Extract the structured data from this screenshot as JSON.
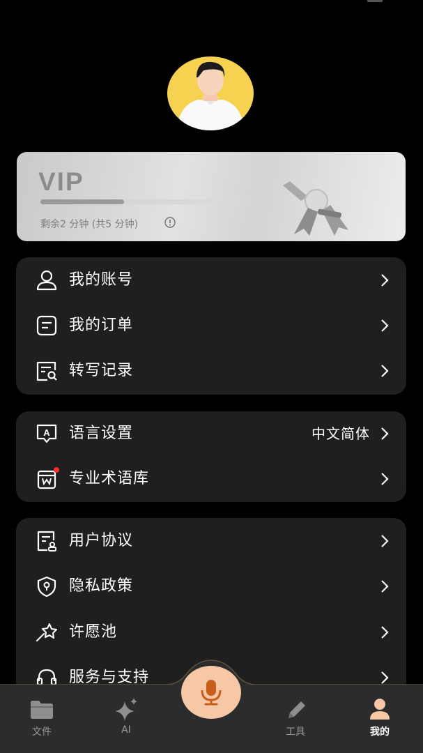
{
  "profile": {
    "avatar_icon": "user-avatar"
  },
  "vip": {
    "title": "VIP",
    "remaining_text": "剩余2 分钟 (共5 分钟)",
    "remaining_minutes": 2,
    "total_minutes": 5,
    "progress_fraction": 0.4
  },
  "groups": {
    "account": [
      {
        "label": "我的账号",
        "icon": "user-icon"
      },
      {
        "label": "我的订单",
        "icon": "order-icon"
      },
      {
        "label": "转写记录",
        "icon": "transcript-record-icon"
      }
    ],
    "settings": [
      {
        "label": "语言设置",
        "icon": "language-icon",
        "value": "中文简体"
      },
      {
        "label": "专业术语库",
        "icon": "glossary-icon",
        "badge": "red-dot"
      }
    ],
    "info": [
      {
        "label": "用户协议",
        "icon": "agreement-icon"
      },
      {
        "label": "隐私政策",
        "icon": "privacy-shield-icon"
      },
      {
        "label": "许愿池",
        "icon": "wish-icon"
      },
      {
        "label": "服务与支持",
        "icon": "headset-icon"
      }
    ]
  },
  "tabbar": {
    "tabs": [
      {
        "label": "文件",
        "icon": "folder-icon"
      },
      {
        "label": "AI",
        "icon": "sparkle-icon"
      },
      {
        "label": "工具",
        "icon": "pen-icon"
      },
      {
        "label": "我的",
        "icon": "profile-icon",
        "active": true
      }
    ],
    "center_button_icon": "microphone-icon"
  },
  "colors": {
    "background": "#000000",
    "card": "#1f1f1f",
    "avatar_bg": "#f7d150",
    "mic_button": "#f6c8a6",
    "mic_icon": "#c95d1a",
    "badge": "#ff2b2b"
  }
}
